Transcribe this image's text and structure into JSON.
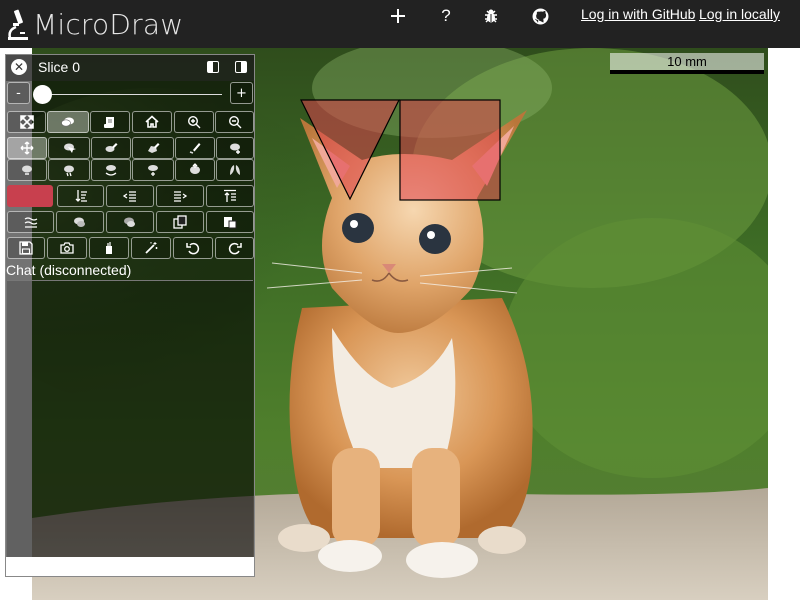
{
  "app": {
    "title": "MicroDraw"
  },
  "topbar": {
    "icons": [
      {
        "name": "plus-icon",
        "glyph": "+"
      },
      {
        "name": "help-icon",
        "glyph": "?"
      },
      {
        "name": "bug-icon",
        "glyph": "bug"
      },
      {
        "name": "github-icon",
        "glyph": "github"
      }
    ],
    "login_github": "Log in with GitHub",
    "login_locally": "Log in locally"
  },
  "viewer": {
    "scalebar_label": "10 mm"
  },
  "panel": {
    "slice_label": "Slice 0",
    "slider_minus": "-",
    "slider_plus": "+",
    "slider_value": 0,
    "current_color": "#c8404e",
    "chat_label": "Chat (disconnected)",
    "chat_input_value": ""
  },
  "colors": {
    "topbar": "#222222",
    "annotation_fill": "#e0424f",
    "annotation_stroke": "#000000"
  }
}
